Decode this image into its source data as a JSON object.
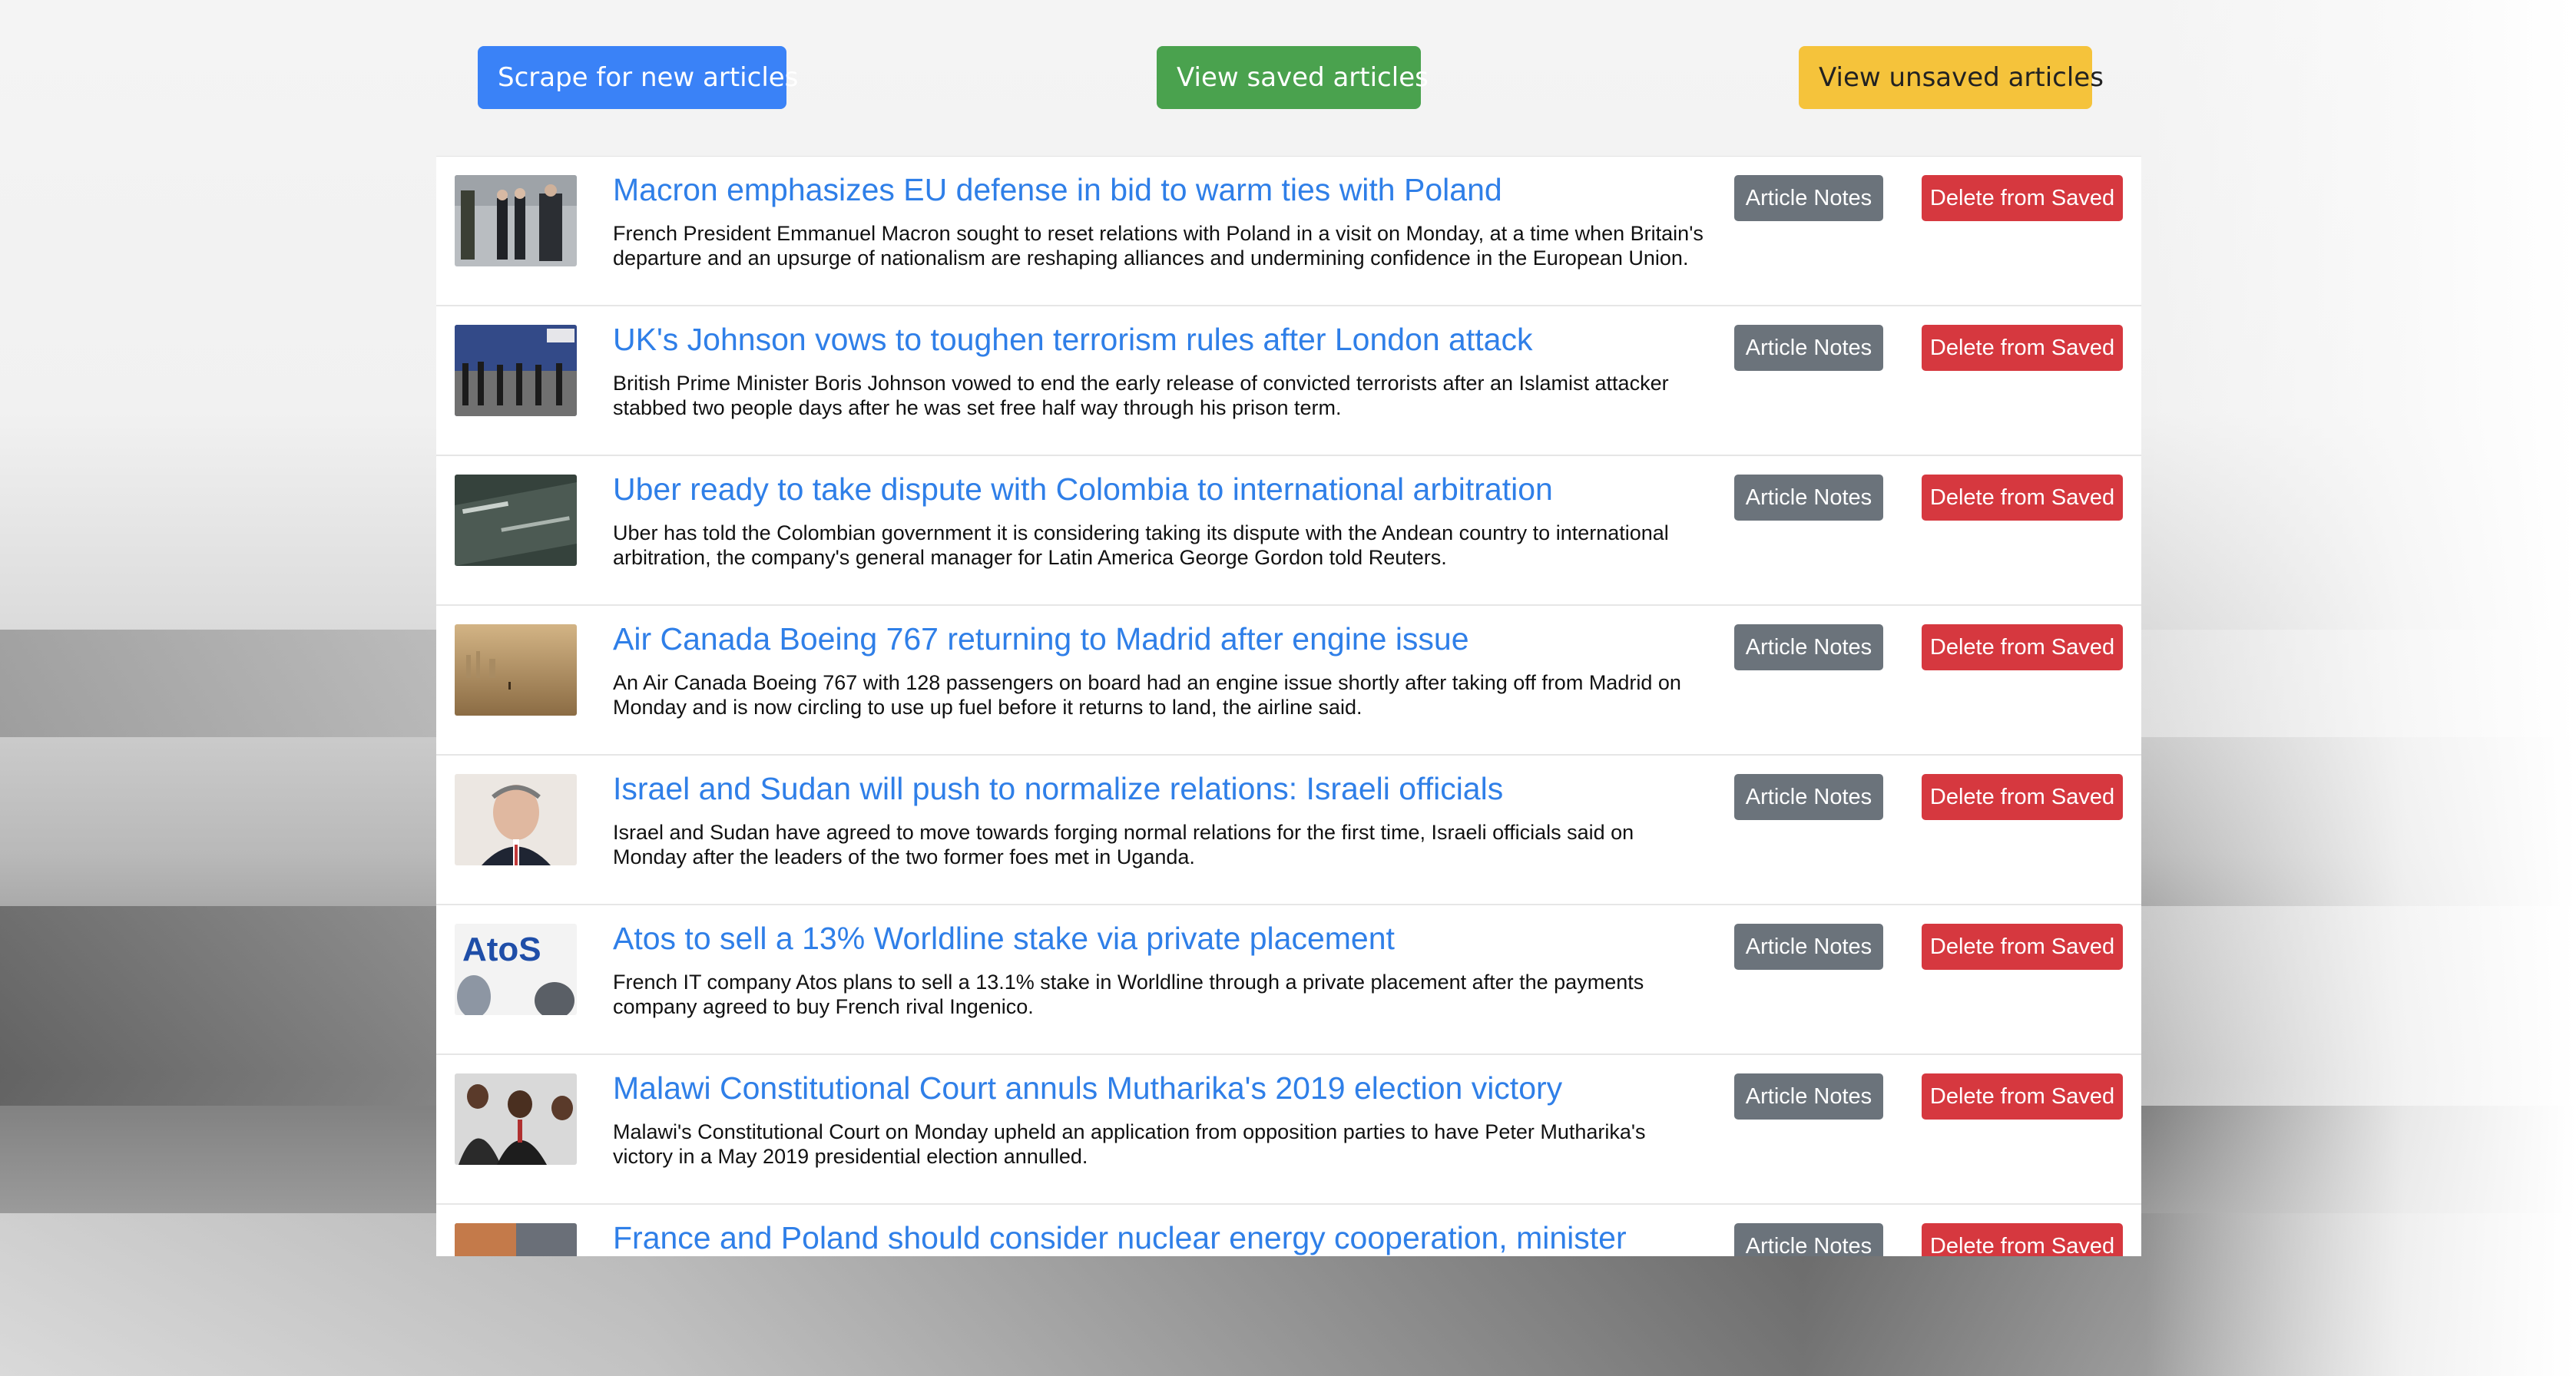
{
  "toolbar": {
    "scrape_label": "Scrape for new articles",
    "saved_label": "View saved articles",
    "unsaved_label": "View unsaved articles"
  },
  "colors": {
    "primary": "#3a82f7",
    "success": "#4aa24e",
    "warning": "#f5c33b",
    "secondary": "#6b737b",
    "danger": "#d6383f",
    "link": "#2f7fe8"
  },
  "articles": [
    {
      "title": "Macron emphasizes EU defense in bid to warm ties with Poland",
      "summary": "French President Emmanuel Macron sought to reset relations with Poland in a visit on Monday, at a time when Britain's departure and an upsurge of nationalism are reshaping alliances and undermining confidence in the European Union.",
      "notes_label": "Article Notes",
      "delete_label": "Delete from Saved",
      "thumb_colors": [
        "#b8bcc0",
        "#2b2b2b"
      ]
    },
    {
      "title": "UK's Johnson vows to toughen terrorism rules after London attack",
      "summary": "British Prime Minister Boris Johnson vowed to end the early release of convicted terrorists after an Islamist attacker stabbed two people days after he was set free half way through his prison term.",
      "notes_label": "Article Notes",
      "delete_label": "Delete from Saved",
      "thumb_colors": [
        "#3a4f8a",
        "#1f1f1f"
      ]
    },
    {
      "title": "Uber ready to take dispute with Colombia to international arbitration",
      "summary": "Uber has told the Colombian government it is considering taking its dispute with the Andean country to international arbitration, the company's general manager for Latin America George Gordon told Reuters.",
      "notes_label": "Article Notes",
      "delete_label": "Delete from Saved",
      "thumb_colors": [
        "#3d4a44",
        "#1e2824"
      ]
    },
    {
      "title": "Air Canada Boeing 767 returning to Madrid after engine issue",
      "summary": "An Air Canada Boeing 767 with 128 passengers on board had an engine issue shortly after taking off from Madrid on Monday and is now circling to use up fuel before it returns to land, the airline said.",
      "notes_label": "Article Notes",
      "delete_label": "Delete from Saved",
      "thumb_colors": [
        "#c9a877",
        "#8a6a40"
      ]
    },
    {
      "title": "Israel and Sudan will push to normalize relations: Israeli officials",
      "summary": "Israel and Sudan have agreed to move towards forging normal relations for the first time, Israeli officials said on Monday after the leaders of the two former foes met in Uganda.",
      "notes_label": "Article Notes",
      "delete_label": "Delete from Saved",
      "thumb_colors": [
        "#e8e2dc",
        "#2a3040"
      ]
    },
    {
      "title": "Atos to sell a 13% Worldline stake via private placement",
      "summary": "French IT company Atos plans to sell a 13.1% stake in Worldline through a private placement after the payments company agreed to buy French rival Ingenico.",
      "notes_label": "Article Notes",
      "delete_label": "Delete from Saved",
      "thumb_colors": [
        "#f2f2f2",
        "#1f4ea8"
      ],
      "thumb_text": "AtoS"
    },
    {
      "title": "Malawi Constitutional Court annuls Mutharika's 2019 election victory",
      "summary": "Malawi's Constitutional Court on Monday upheld an application from opposition parties to have Peter Mutharika's victory in a May 2019 presidential election annulled.",
      "notes_label": "Article Notes",
      "delete_label": "Delete from Saved",
      "thumb_colors": [
        "#d8d8d8",
        "#2a2a2a"
      ]
    },
    {
      "title": "France and Poland should consider nuclear energy cooperation, minister",
      "summary": "",
      "notes_label": "Article Notes",
      "delete_label": "Delete from Saved",
      "thumb_colors": [
        "#c47a4a",
        "#6a6f78"
      ]
    }
  ]
}
